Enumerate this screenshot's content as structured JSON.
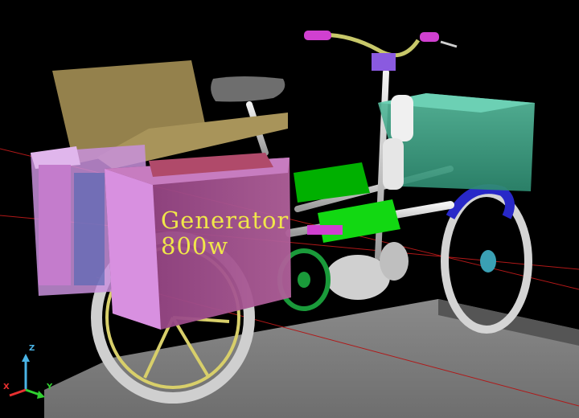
{
  "label": {
    "line1": "Generator",
    "line2": "800w"
  },
  "axes": {
    "x": "X",
    "y": "Y",
    "z": "Z"
  },
  "colors": {
    "background": "#000000",
    "platform": "#7d7d7d",
    "generator_box": "#a0508c",
    "side_box": "#c88cdc",
    "lid": "#a08c50",
    "battery": "#00c800",
    "cargo_box": "#46b496",
    "wheel_rim": "#3c3cdc",
    "label_text": "#f0e64a"
  },
  "icons": [
    "axis-triad-icon"
  ]
}
